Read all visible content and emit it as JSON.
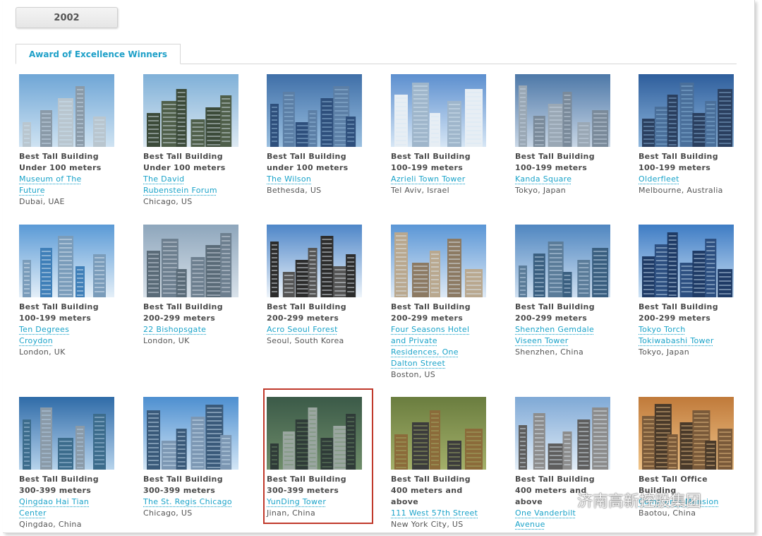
{
  "year_button": "2002",
  "tab_label": "Award of Excellence Winners",
  "cards": [
    {
      "cat1": "Best Tall Building",
      "cat2": "Under 100 meters",
      "name1": "Museum of The",
      "name2": "Future",
      "loc": "Dubai, UAE"
    },
    {
      "cat1": "Best Tall Building",
      "cat2": "Under 100 meters",
      "name1": "The David",
      "name2": "Rubenstein Forum",
      "loc": "Chicago, US"
    },
    {
      "cat1": "Best Tall Building",
      "cat2": "under 100 meters",
      "name1": "The Wilson",
      "name2": "",
      "loc": "Bethesda, US"
    },
    {
      "cat1": "Best Tall Building",
      "cat2": "100-199 meters",
      "name1": "Azrieli Town Tower",
      "name2": "",
      "loc": "Tel Aviv, Israel"
    },
    {
      "cat1": "Best Tall Building",
      "cat2": "100-199 meters",
      "name1": "Kanda Square",
      "name2": "",
      "loc": "Tokyo, Japan"
    },
    {
      "cat1": "Best Tall Building",
      "cat2": "100-199 meters",
      "name1": "Olderfleet",
      "name2": "",
      "loc": "Melbourne, Australia"
    },
    {
      "cat1": "Best Tall Building",
      "cat2": "100-199 meters",
      "name1": "Ten Degrees",
      "name2": "Croydon",
      "loc": "London, UK"
    },
    {
      "cat1": "Best Tall Building",
      "cat2": "200-299 meters",
      "name1": "22 Bishopsgate",
      "name2": "",
      "loc": "London, UK"
    },
    {
      "cat1": "Best Tall Building",
      "cat2": "200-299 meters",
      "name1": "Acro Seoul Forest",
      "name2": "",
      "loc": "Seoul, South Korea"
    },
    {
      "cat1": "Best Tall Building",
      "cat2": "200-299 meters",
      "name1": "Four Seasons Hotel",
      "name2": "and Private",
      "name3": "Residences, One",
      "name4": "Dalton Street",
      "loc": "Boston, US"
    },
    {
      "cat1": "Best Tall Building",
      "cat2": "200-299 meters",
      "name1": "Shenzhen Gemdale",
      "name2": "Viseen Tower",
      "loc": "Shenzhen, China"
    },
    {
      "cat1": "Best Tall Building",
      "cat2": "200-299 meters",
      "name1": "Tokyo Torch",
      "name2": "Tokiwabashi Tower",
      "loc": "Tokyo, Japan"
    },
    {
      "cat1": "Best Tall Building",
      "cat2": "300-399 meters",
      "name1": "Qingdao Hai Tian",
      "name2": "Center",
      "loc": "Qingdao, China"
    },
    {
      "cat1": "Best Tall Building",
      "cat2": "300-399 meters",
      "name1": "The St. Regis Chicago",
      "name2": "",
      "loc": "Chicago, US"
    },
    {
      "cat1": "Best Tall Building",
      "cat2": "300-399 meters",
      "name1": "YunDing Tower",
      "name2": "",
      "loc": "Jinan, China"
    },
    {
      "cat1": "Best Tall Building",
      "cat2": "400 meters and",
      "cat3": "above",
      "name1": "111 West 57th Street",
      "name2": "",
      "loc": "New York City, US"
    },
    {
      "cat1": "Best Tall Building",
      "cat2": "400 meters and",
      "cat3": "above",
      "name1": "One Vanderbilt",
      "name2": "Avenue",
      "loc": ""
    },
    {
      "cat1": "Best Tall Office",
      "cat2": "Building",
      "name1": "Commerce Mansion",
      "name2": "",
      "loc": "Baotou, China"
    }
  ],
  "watermark_text": "济南高新控股集团",
  "colors": {
    "link": "#1aa3c9",
    "highlight": "#c0392b",
    "tab_text": "#1ea0c8"
  }
}
